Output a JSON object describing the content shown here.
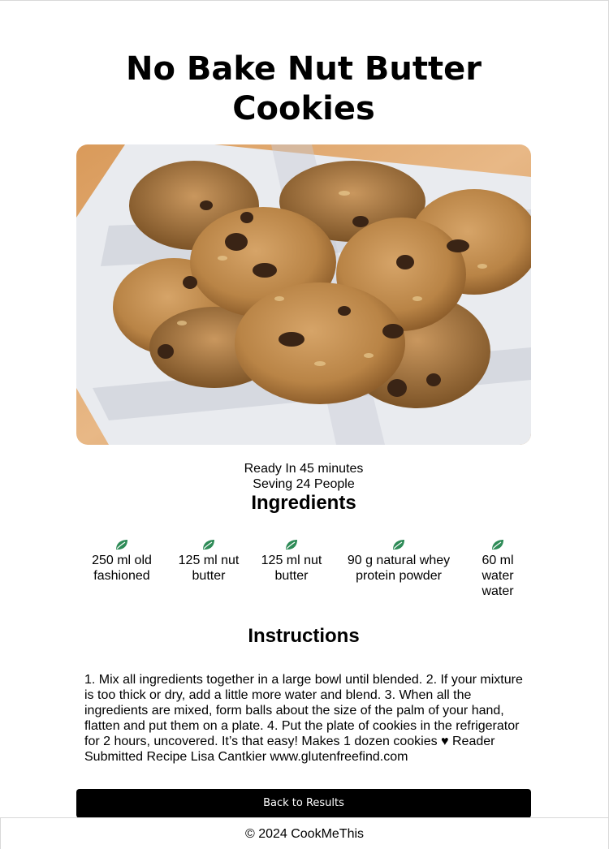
{
  "recipe": {
    "title": "No Bake Nut Butter Cookies",
    "image_alt": "No Bake Nut Butter Cookies",
    "ready_in": "Ready In 45 minutes",
    "serving": "Seving 24 People"
  },
  "ingredients_section": {
    "heading": "Ingredients",
    "icon": "leaf-icon",
    "icon_color": "#2e8b57",
    "items": [
      {
        "text": "250 ml old fashioned"
      },
      {
        "text": "125 ml nut butter"
      },
      {
        "text": "125 ml nut butter"
      },
      {
        "text": "90 g natural whey protein powder"
      },
      {
        "text": "60 ml water water"
      }
    ]
  },
  "instructions_section": {
    "heading": "Instructions",
    "text": "1. Mix all ingredients together in a large bowl until blended. 2. If your mixture is too thick or dry, add a little more water and blend. 3. When all the ingredients are mixed, form balls about the size of the palm of your hand, flatten and put them on a plate. 4. Put the plate of cookies in the refrigerator for 2 hours, uncovered. It’s that easy! Makes 1 dozen cookies ♥    Reader Submitted Recipe  Lisa Cantkier www.glutenfreefind.com"
  },
  "actions": {
    "back_label": "Back to Results"
  },
  "footer": {
    "text": "© 2024 CookMeThis"
  }
}
